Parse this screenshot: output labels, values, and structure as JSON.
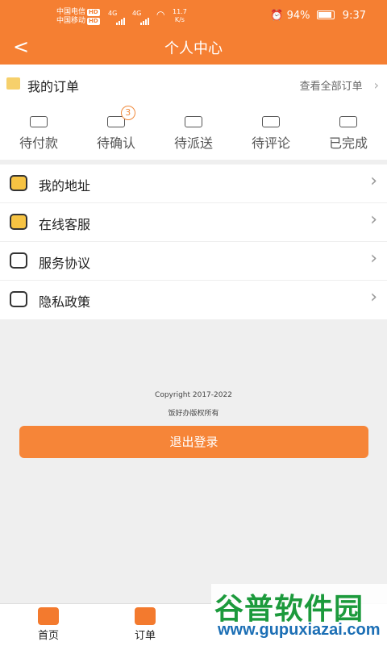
{
  "status_bar": {
    "carrier1": "中国电信",
    "carrier2": "中国移动",
    "hd": "HD",
    "net": "4G",
    "speed_value": "11.7",
    "speed_unit": "K/s",
    "battery": "94%",
    "time": "9:37"
  },
  "header": {
    "back": "<",
    "title": "个人中心"
  },
  "orders": {
    "title": "我的订单",
    "view_all": "查看全部订单",
    "statuses": [
      {
        "label": "待付款",
        "icon": "wallet-icon"
      },
      {
        "label": "待确认",
        "icon": "message-icon",
        "badge": "3"
      },
      {
        "label": "待派送",
        "icon": "delivery-icon"
      },
      {
        "label": "待评论",
        "icon": "comment-icon"
      },
      {
        "label": "已完成",
        "icon": "done-icon"
      }
    ]
  },
  "menu": [
    {
      "label": "我的地址",
      "icon": "location-icon"
    },
    {
      "label": "在线客服",
      "icon": "chat-icon"
    },
    {
      "label": "服务协议",
      "icon": "agreement-icon"
    },
    {
      "label": "隐私政策",
      "icon": "privacy-icon"
    }
  ],
  "footer": {
    "copyright": "Copyright 2017-2022",
    "rights": "饭好办版权所有",
    "logout": "退出登录"
  },
  "bottom_nav": [
    {
      "label": "首页",
      "icon": "home-icon"
    },
    {
      "label": "订单",
      "icon": "orders-icon"
    }
  ],
  "watermark": {
    "title": "谷普软件园",
    "url": "www.gupuxiazai.com"
  },
  "colors": {
    "accent": "#f57f32",
    "button": "#f68538",
    "watermark_green": "#1c9a3c",
    "watermark_blue": "#1c6fb5"
  }
}
